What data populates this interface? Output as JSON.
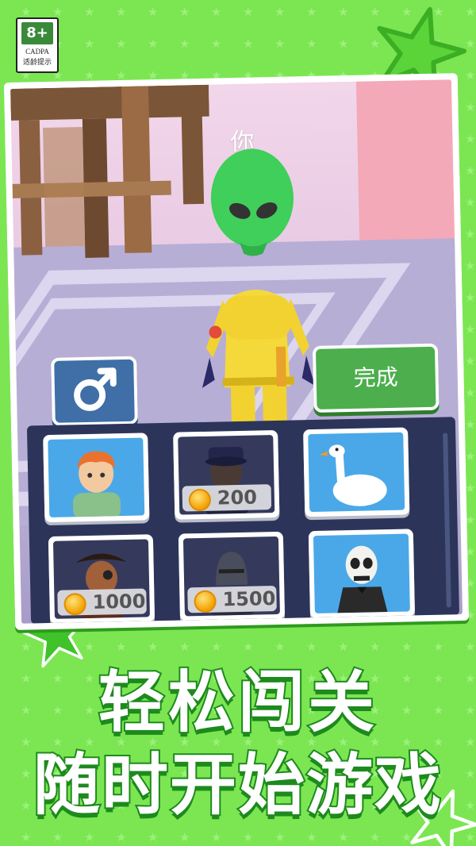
{
  "badge": {
    "age": "8+",
    "org": "CADPA",
    "tip": "适龄提示"
  },
  "game": {
    "player_label": "你",
    "done_label": "完成",
    "gender_icon": "male-symbol-icon",
    "skins": [
      {
        "name": "boy-skin",
        "price": ""
      },
      {
        "name": "police-skin",
        "price": "200"
      },
      {
        "name": "goose-skin",
        "price": ""
      },
      {
        "name": "pirate-skin",
        "price": "1000"
      },
      {
        "name": "knight-skin",
        "price": "1500"
      },
      {
        "name": "skeleton-skin",
        "price": ""
      }
    ]
  },
  "headline": {
    "line1": "轻松闯关",
    "line2": "随时开始游戏"
  },
  "colors": {
    "background": "#7be652",
    "panel": "#2c3559",
    "done": "#4cae4c",
    "gender": "#3f6fa6",
    "title_stroke": "#1d8a1d"
  }
}
